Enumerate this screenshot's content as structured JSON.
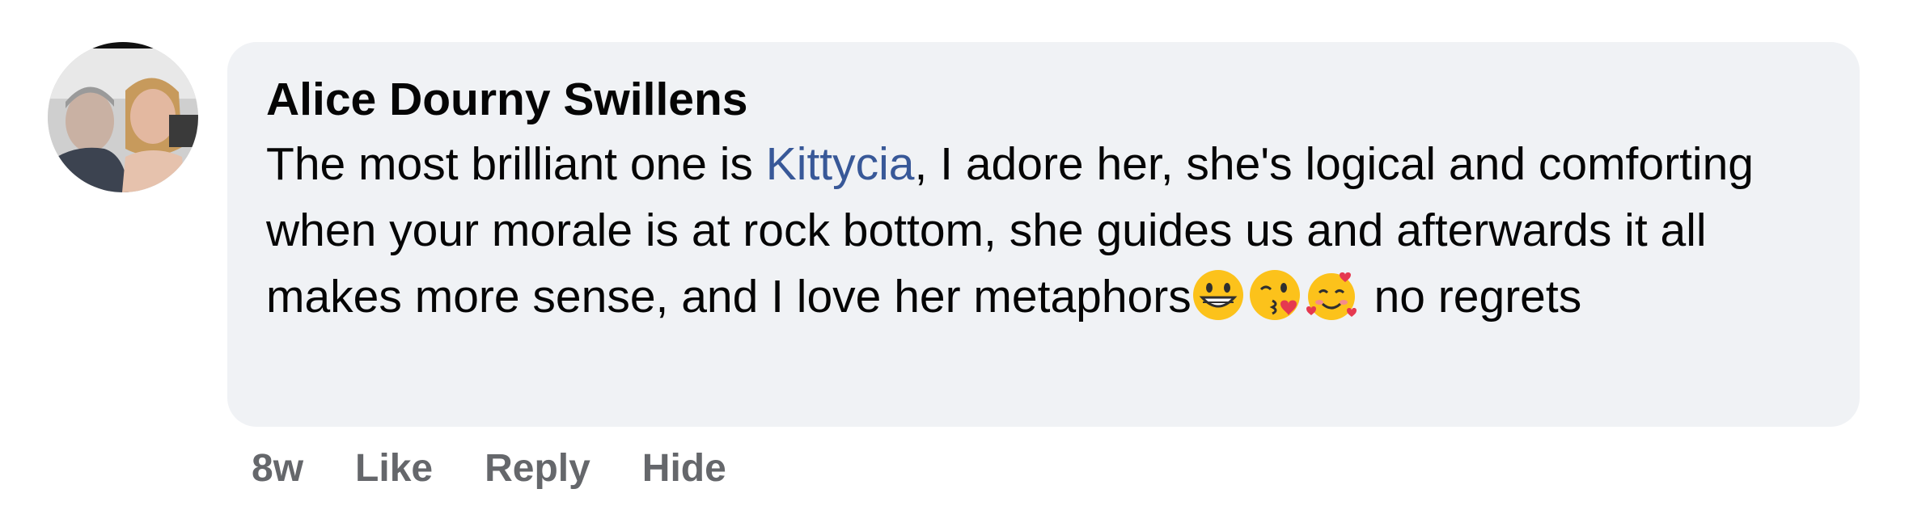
{
  "comment": {
    "author": "Alice Dourny Swillens",
    "text": {
      "before_mention": "The most brilliant one is ",
      "mention": "Kittycia",
      "after_mention": ", I adore her, she's logical and comforting when your morale is at rock bottom, she guides us and afterwards it all makes more sense, and I love her metaphors",
      "after_emojis": " no regrets"
    },
    "emojis": [
      "grinning-face-emoji",
      "face-blowing-kiss-emoji",
      "smiling-face-with-hearts-emoji"
    ],
    "timestamp": "8w",
    "actions": {
      "like": "Like",
      "reply": "Reply",
      "hide": "Hide"
    }
  },
  "colors": {
    "bubble_background": "#f0f2f5",
    "mention": "#385898",
    "action_text": "#65676b",
    "text": "#050505"
  }
}
